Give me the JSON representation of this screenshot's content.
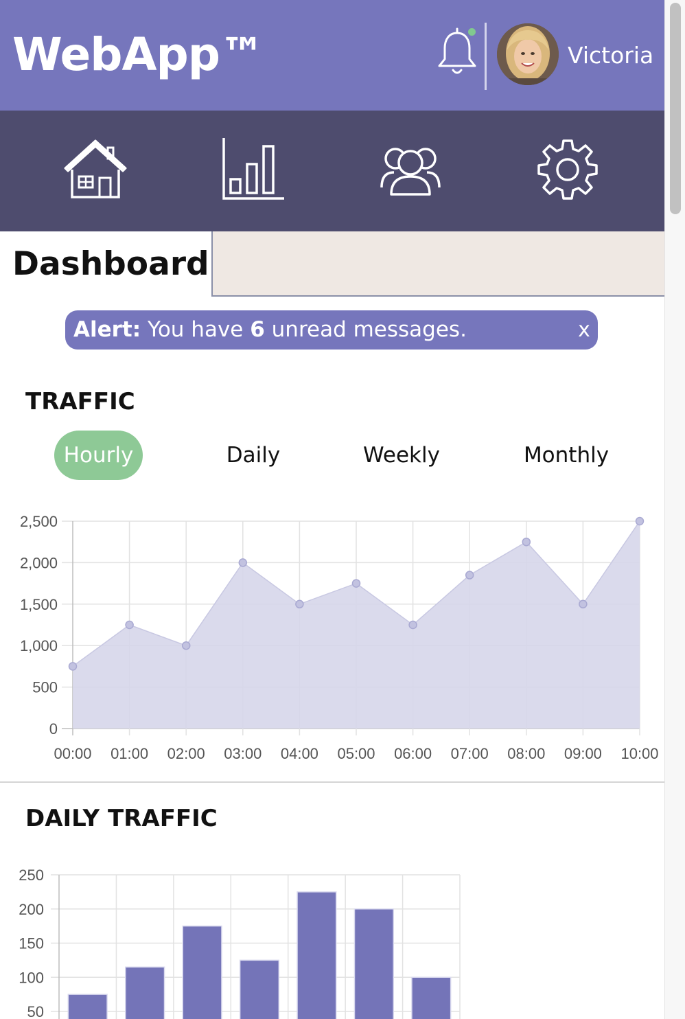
{
  "header": {
    "app_title": "WebApp™",
    "user_name": "Victoria",
    "notification_indicator_color": "#81c98f"
  },
  "nav": {
    "items": [
      {
        "name": "home",
        "icon": "home-icon"
      },
      {
        "name": "analytics",
        "icon": "bar-chart-icon"
      },
      {
        "name": "members",
        "icon": "users-icon"
      },
      {
        "name": "settings",
        "icon": "gear-icon"
      }
    ]
  },
  "dashboard": {
    "title": "Dashboard"
  },
  "alert": {
    "label": "Alert:",
    "text_before": " You have ",
    "count": "6",
    "text_after": " unread messages.",
    "close": "x"
  },
  "traffic": {
    "title": "TRAFFIC",
    "tabs": [
      "Hourly",
      "Daily",
      "Weekly",
      "Monthly"
    ],
    "active_tab": "Hourly"
  },
  "daily_traffic": {
    "title": "DAILY TRAFFIC"
  },
  "colors": {
    "header": "#7676bc",
    "nav": "#4e4c6e",
    "accent_green": "#8ec996",
    "bar": "#7474b8",
    "area_fill": "#d6d6ea"
  },
  "chart_data": [
    {
      "type": "area",
      "categories": [
        "00:00",
        "01:00",
        "02:00",
        "03:00",
        "04:00",
        "05:00",
        "06:00",
        "07:00",
        "08:00",
        "09:00",
        "10:00"
      ],
      "values": [
        750,
        1250,
        1000,
        2000,
        1500,
        1750,
        1250,
        1850,
        2250,
        1500,
        2500
      ],
      "ylim": [
        0,
        2500
      ],
      "yticks": [
        "0",
        "500",
        "1,000",
        "1,500",
        "2,000",
        "2,500"
      ],
      "grid": true,
      "legend": false
    },
    {
      "type": "bar",
      "values": [
        75,
        115,
        175,
        125,
        225,
        200,
        100
      ],
      "ylim": [
        0,
        250
      ],
      "yticks": [
        "50",
        "100",
        "150",
        "200",
        "250"
      ],
      "grid": true,
      "legend": false
    }
  ]
}
